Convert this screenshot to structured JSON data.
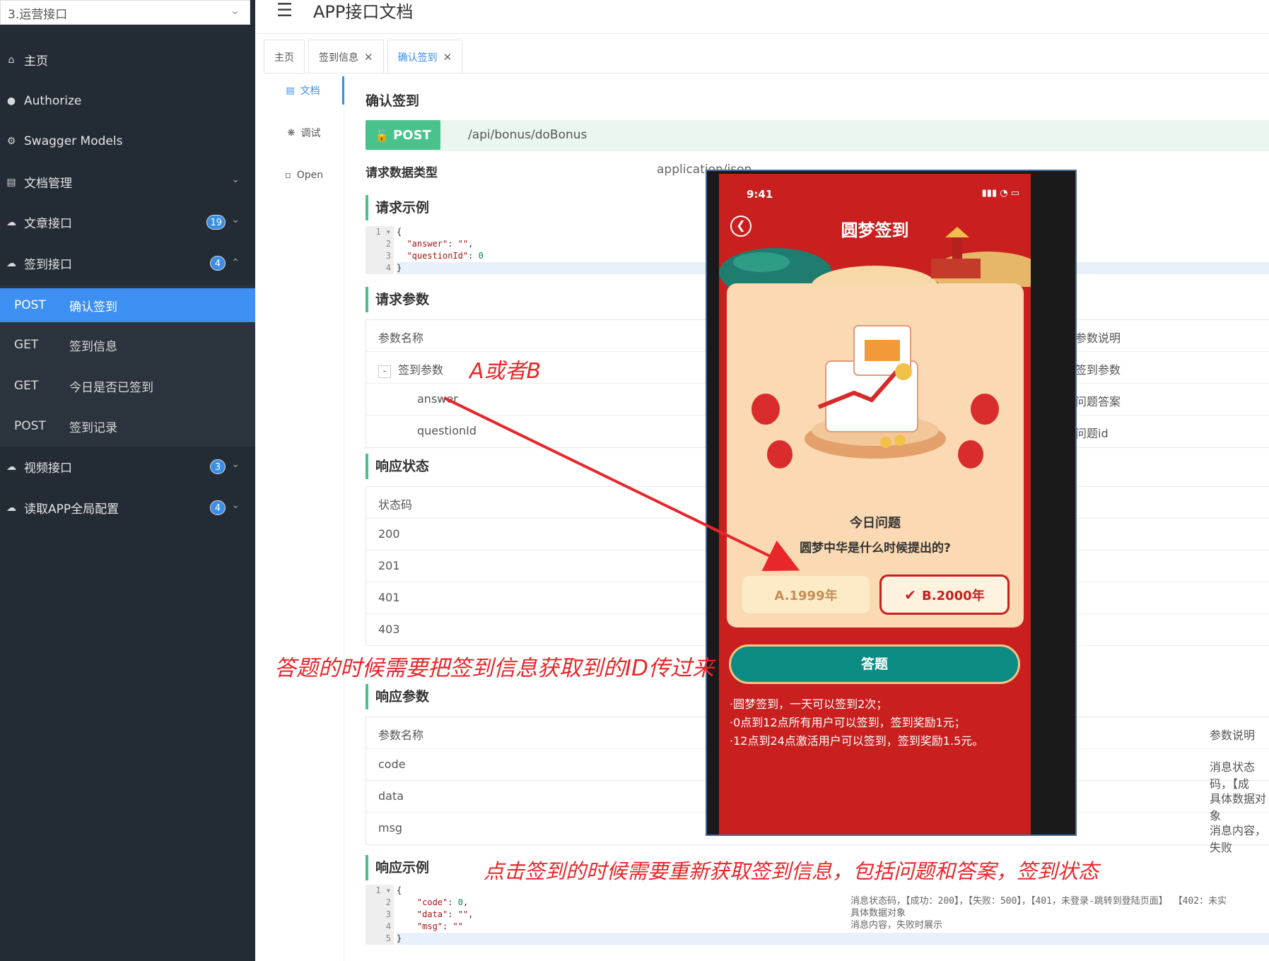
{
  "sidebar": {
    "group_select": "3.运营接口",
    "items": [
      {
        "label": "主页"
      },
      {
        "label": "Authorize"
      },
      {
        "label": "Swagger Models"
      },
      {
        "label": "文档管理"
      },
      {
        "label": "文章接口",
        "badge": "19"
      },
      {
        "label": "签到接口",
        "badge": "4"
      },
      {
        "label": "视频接口",
        "badge": "3"
      },
      {
        "label": "读取APP全局配置",
        "badge": "4"
      }
    ],
    "sub_items": [
      {
        "method": "POST",
        "label": "确认签到"
      },
      {
        "method": "GET",
        "label": "签到信息"
      },
      {
        "method": "GET",
        "label": "今日是否已签到"
      },
      {
        "method": "POST",
        "label": "签到记录"
      }
    ]
  },
  "header": {
    "title": "APP接口文档"
  },
  "tabs": [
    {
      "label": "主页"
    },
    {
      "label": "签到信息"
    },
    {
      "label": "确认签到"
    }
  ],
  "docnav": [
    {
      "label": "文档"
    },
    {
      "label": "调试"
    },
    {
      "label": "Open"
    }
  ],
  "doc": {
    "title": "确认签到",
    "method": "POST",
    "path": "/api/bonus/doBonus",
    "req_type_label": "请求数据类型",
    "req_type_value": "application/json",
    "req_example_title": "请求示例",
    "req_params_title": "请求参数",
    "resp_status_title": "响应状态",
    "resp_params_title": "响应参数",
    "resp_example_title": "响应示例",
    "req_params_header": [
      "参数名称",
      "参数说明"
    ],
    "req_params": [
      {
        "name": "签到参数",
        "desc": "签到参数"
      },
      {
        "name": "answer",
        "desc": "问题答案"
      },
      {
        "name": "questionId",
        "desc": "问题id"
      }
    ],
    "status_header": "状态码",
    "status_codes": [
      "200",
      "201",
      "401",
      "403"
    ],
    "resp_params_header": [
      "参数名称",
      "参数说明"
    ],
    "resp_params": [
      {
        "name": "code",
        "desc": "消息状态码，【成"
      },
      {
        "name": "data",
        "desc": "具体数据对象"
      },
      {
        "name": "msg",
        "desc": "消息内容，失败"
      }
    ],
    "resp_desc_lines": [
      "消息状态码，【成功：200】，【失败：500】，【401，未登录-跳转到登陆页面】 【402：未实",
      "具体数据对象",
      "消息内容，失败时展示"
    ]
  },
  "annotations": {
    "a_or_b": "A或者B",
    "pass_id": "答题的时候需要把签到信息获取到的ID传过来",
    "refresh": "点击签到的时候需要重新获取签到信息，包括问题和答案，签到状态"
  },
  "phone": {
    "time": "9:41",
    "title": "圆梦签到",
    "question_title": "今日问题",
    "question": "圆梦中华是什么时候提出的?",
    "option_a": "A.1999年",
    "option_b": "B.2000年",
    "answer_button": "答题",
    "rules": [
      "·圆梦签到，一天可以签到2次；",
      "·0点到12点所有用户可以签到，签到奖励1元；",
      "·12点到24点激活用户可以签到，签到奖励1.5元。"
    ]
  }
}
